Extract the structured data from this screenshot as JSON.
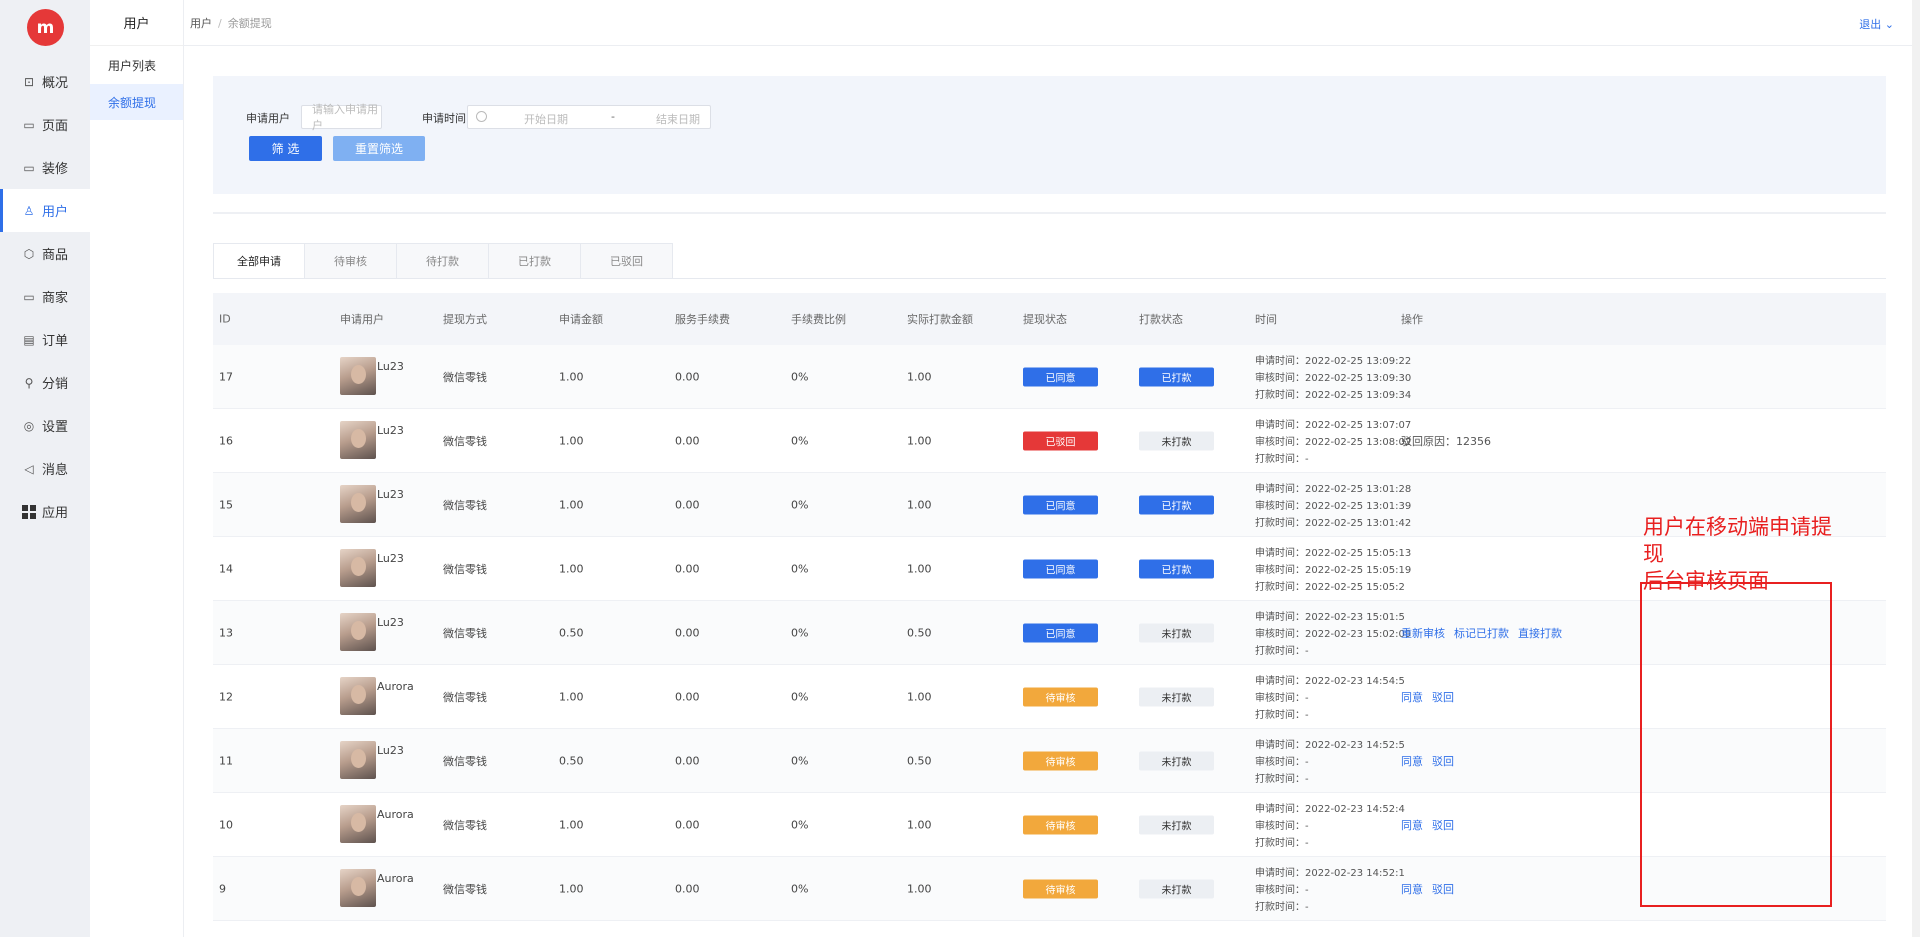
{
  "logo": {
    "text": "m"
  },
  "nav": [
    {
      "label": "概况",
      "icon": "chart-icon",
      "glyph": "⊡"
    },
    {
      "label": "页面",
      "icon": "page-icon",
      "glyph": "▭"
    },
    {
      "label": "装修",
      "icon": "decorate-icon",
      "glyph": "▭"
    },
    {
      "label": "用户",
      "icon": "user-icon",
      "glyph": "♙"
    },
    {
      "label": "商品",
      "icon": "goods-icon",
      "glyph": "⬡"
    },
    {
      "label": "商家",
      "icon": "store-icon",
      "glyph": "▭"
    },
    {
      "label": "订单",
      "icon": "order-icon",
      "glyph": "▤"
    },
    {
      "label": "分销",
      "icon": "distribution-icon",
      "glyph": "⚲"
    },
    {
      "label": "设置",
      "icon": "settings-icon",
      "glyph": "◎"
    },
    {
      "label": "消息",
      "icon": "message-icon",
      "glyph": "◁"
    },
    {
      "label": "应用",
      "icon": "apps-icon",
      "glyph": ""
    }
  ],
  "subnav": {
    "title": "用户",
    "items": [
      "用户列表",
      "余额提现"
    ]
  },
  "topbar": {
    "crumb_parent": "用户",
    "crumb_sep": "/",
    "crumb_current": "余额提现",
    "logout": "退出 ⌄"
  },
  "filter": {
    "user_label": "申请用户",
    "user_placeholder": "请输入申请用户",
    "time_label": "申请时间",
    "start_placeholder": "开始日期",
    "date_dash": "-",
    "end_placeholder": "结束日期",
    "submit": "筛 选",
    "reset": "重置筛选"
  },
  "tabs": [
    "全部申请",
    "待审核",
    "待打款",
    "已打款",
    "已驳回"
  ],
  "columns": [
    "ID",
    "申请用户",
    "提现方式",
    "申请金额",
    "服务手续费",
    "手续费比例",
    "实际打款金额",
    "提现状态",
    "打款状态",
    "时间",
    "操作"
  ],
  "rows": [
    {
      "id": "17",
      "user": "Lu23",
      "method": "微信零钱",
      "amount": "1.00",
      "fee": "0.00",
      "ratio": "0%",
      "actual": "1.00",
      "status": "已同意",
      "status_color": "blue",
      "pay": "已打款",
      "pay_color": "blue",
      "t1": "申请时间：2022-02-25 13:09:22",
      "t2": "审核时间：2022-02-25 13:09:30",
      "t3": "打款时间：2022-02-25 13:09:34",
      "ops": [],
      "note": ""
    },
    {
      "id": "16",
      "user": "Lu23",
      "method": "微信零钱",
      "amount": "1.00",
      "fee": "0.00",
      "ratio": "0%",
      "actual": "1.00",
      "status": "已驳回",
      "status_color": "red",
      "pay": "未打款",
      "pay_color": "grey",
      "t1": "申请时间：2022-02-25 13:07:07",
      "t2": "审核时间：2022-02-25 13:08:02",
      "t3": "打款时间：-",
      "ops": [],
      "note": "驳回原因：12356"
    },
    {
      "id": "15",
      "user": "Lu23",
      "method": "微信零钱",
      "amount": "1.00",
      "fee": "0.00",
      "ratio": "0%",
      "actual": "1.00",
      "status": "已同意",
      "status_color": "blue",
      "pay": "已打款",
      "pay_color": "blue",
      "t1": "申请时间：2022-02-25 13:01:28",
      "t2": "审核时间：2022-02-25 13:01:39",
      "t3": "打款时间：2022-02-25 13:01:42",
      "ops": [],
      "note": ""
    },
    {
      "id": "14",
      "user": "Lu23",
      "method": "微信零钱",
      "amount": "1.00",
      "fee": "0.00",
      "ratio": "0%",
      "actual": "1.00",
      "status": "已同意",
      "status_color": "blue",
      "pay": "已打款",
      "pay_color": "blue",
      "t1": "申请时间：2022-02-25 15:05:13",
      "t2": "审核时间：2022-02-25 15:05:19",
      "t3": "打款时间：2022-02-25 15:05:2",
      "ops": [],
      "note": ""
    },
    {
      "id": "13",
      "user": "Lu23",
      "method": "微信零钱",
      "amount": "0.50",
      "fee": "0.00",
      "ratio": "0%",
      "actual": "0.50",
      "status": "已同意",
      "status_color": "blue",
      "pay": "未打款",
      "pay_color": "grey",
      "t1": "申请时间：2022-02-23 15:01:5",
      "t2": "审核时间：2022-02-23 15:02:09",
      "t3": "打款时间：-",
      "ops": [
        "重新审核",
        "标记已打款",
        "直接打款"
      ],
      "note": ""
    },
    {
      "id": "12",
      "user": "Aurora",
      "method": "微信零钱",
      "amount": "1.00",
      "fee": "0.00",
      "ratio": "0%",
      "actual": "1.00",
      "status": "待审核",
      "status_color": "orange",
      "pay": "未打款",
      "pay_color": "grey",
      "t1": "申请时间：2022-02-23 14:54:5",
      "t2": "审核时间：-",
      "t3": "打款时间：-",
      "ops": [
        "同意",
        "驳回"
      ],
      "note": ""
    },
    {
      "id": "11",
      "user": "Lu23",
      "method": "微信零钱",
      "amount": "0.50",
      "fee": "0.00",
      "ratio": "0%",
      "actual": "0.50",
      "status": "待审核",
      "status_color": "orange",
      "pay": "未打款",
      "pay_color": "grey",
      "t1": "申请时间：2022-02-23 14:52:5",
      "t2": "审核时间：-",
      "t3": "打款时间：-",
      "ops": [
        "同意",
        "驳回"
      ],
      "note": ""
    },
    {
      "id": "10",
      "user": "Aurora",
      "method": "微信零钱",
      "amount": "1.00",
      "fee": "0.00",
      "ratio": "0%",
      "actual": "1.00",
      "status": "待审核",
      "status_color": "orange",
      "pay": "未打款",
      "pay_color": "grey",
      "t1": "申请时间：2022-02-23 14:52:4",
      "t2": "审核时间：-",
      "t3": "打款时间：-",
      "ops": [
        "同意",
        "驳回"
      ],
      "note": ""
    },
    {
      "id": "9",
      "user": "Aurora",
      "method": "微信零钱",
      "amount": "1.00",
      "fee": "0.00",
      "ratio": "0%",
      "actual": "1.00",
      "status": "待审核",
      "status_color": "orange",
      "pay": "未打款",
      "pay_color": "grey",
      "t1": "申请时间：2022-02-23 14:52:1",
      "t2": "审核时间：-",
      "t3": "打款时间：-",
      "ops": [
        "同意",
        "驳回"
      ],
      "note": ""
    }
  ],
  "annotation": {
    "line1": "用户在移动端申请提现",
    "line2": "后台审核页面"
  }
}
